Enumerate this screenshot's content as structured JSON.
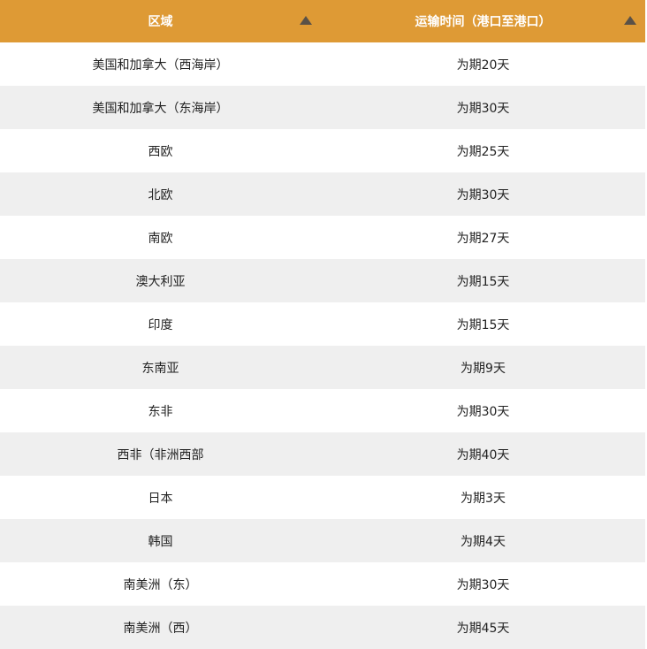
{
  "header": {
    "region_label": "区域",
    "time_label": "运输时间（港口至港口）",
    "sort_icon": "triangle-up-icon"
  },
  "rows": [
    {
      "region": "美国和加拿大（西海岸）",
      "time": "为期20天"
    },
    {
      "region": "美国和加拿大（东海岸）",
      "time": "为期30天"
    },
    {
      "region": "西欧",
      "time": "为期25天"
    },
    {
      "region": "北欧",
      "time": "为期30天"
    },
    {
      "region": "南欧",
      "time": "为期27天"
    },
    {
      "region": "澳大利亚",
      "time": "为期15天"
    },
    {
      "region": "印度",
      "time": "为期15天"
    },
    {
      "region": "东南亚",
      "time": "为期9天"
    },
    {
      "region": "东非",
      "time": "为期30天"
    },
    {
      "region": "西非（非洲西部",
      "time": "为期40天"
    },
    {
      "region": "日本",
      "time": "为期3天"
    },
    {
      "region": "韩国",
      "time": "为期4天"
    },
    {
      "region": "南美洲（东）",
      "time": "为期30天"
    },
    {
      "region": "南美洲（西）",
      "time": "为期45天"
    }
  ],
  "colors": {
    "header_bg": "#de9a35",
    "header_text": "#ffffff",
    "stripe": "#efefef",
    "sort_icon": "#5a5147"
  }
}
